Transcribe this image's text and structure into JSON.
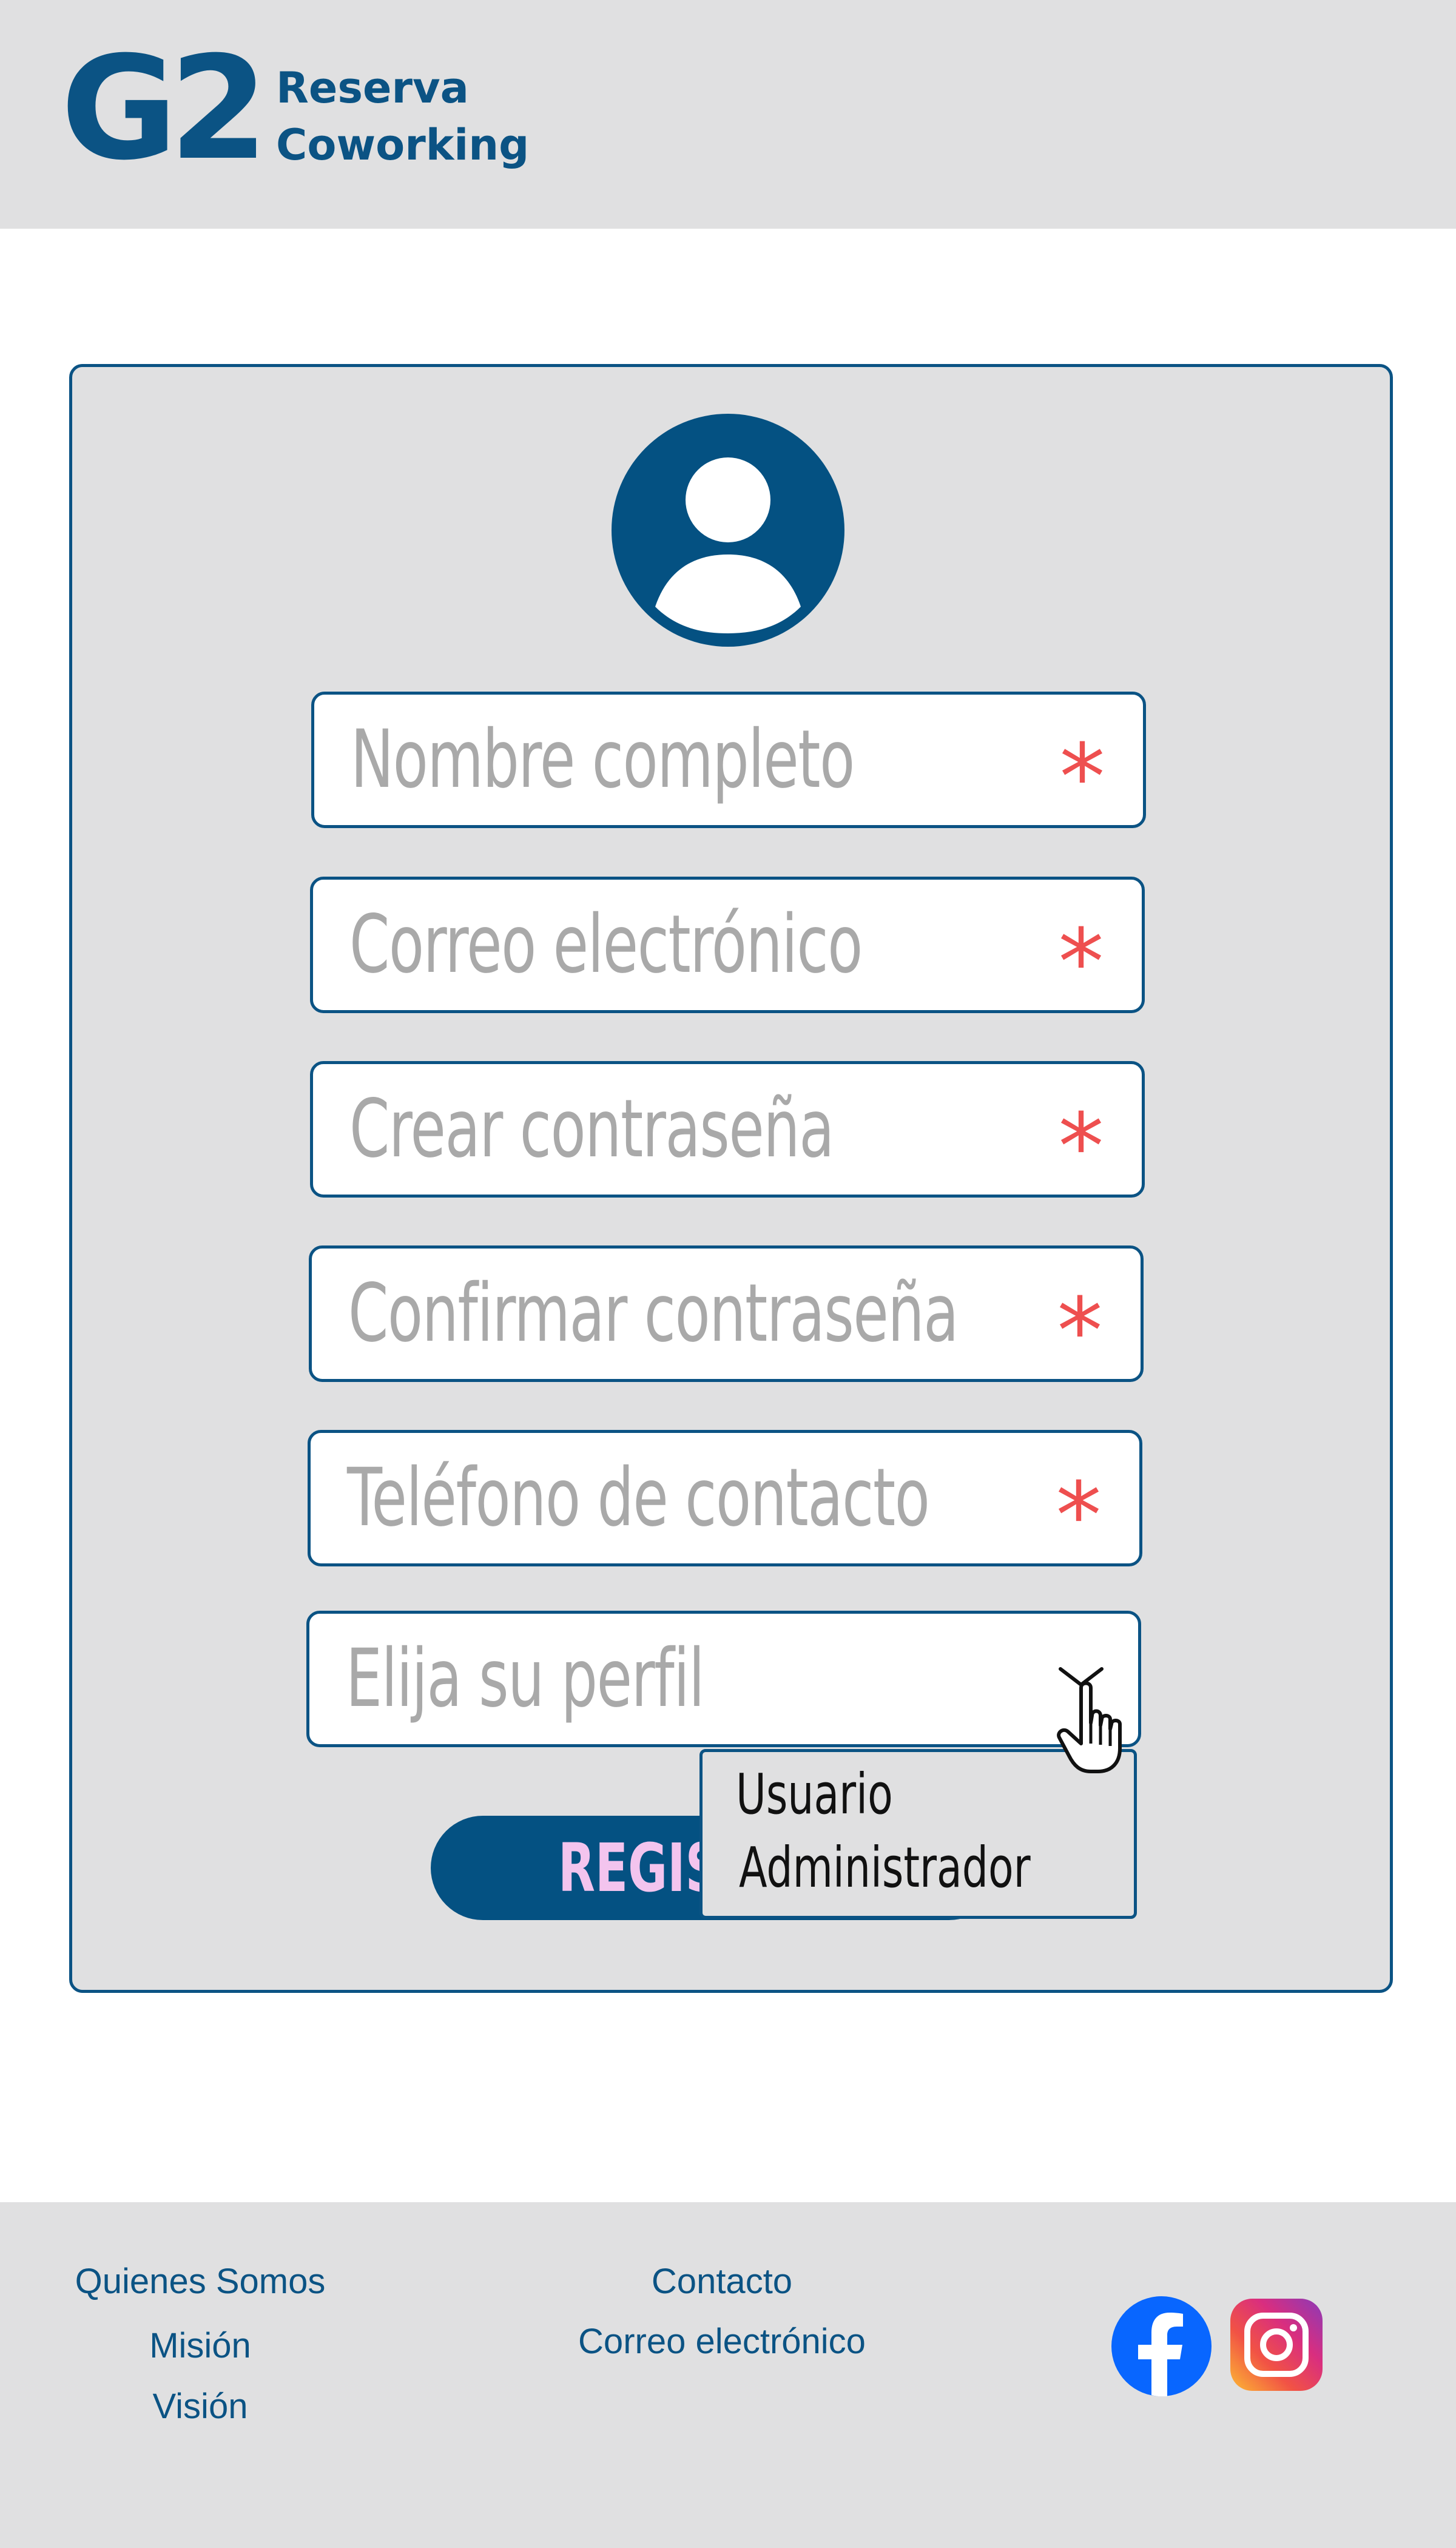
{
  "header": {
    "logo_mark": "G2",
    "logo_line1": "Reserva",
    "logo_line2": "Coworking"
  },
  "form": {
    "fields": [
      {
        "placeholder": "Nombre completo",
        "required_mark": "*"
      },
      {
        "placeholder": "Correo electrónico",
        "required_mark": "*"
      },
      {
        "placeholder": "Crear contraseña",
        "required_mark": "*"
      },
      {
        "placeholder": "Confirmar contraseña",
        "required_mark": "*"
      },
      {
        "placeholder": "Teléfono de contacto",
        "required_mark": "*"
      }
    ],
    "profile_select": {
      "placeholder": "Elija su perfil",
      "options": [
        "Usuario",
        "Administrador"
      ]
    },
    "submit_label": "REGIS"
  },
  "footer": {
    "links_left": [
      "Quienes Somos",
      "Misión",
      "Visión"
    ],
    "links_center": [
      "Contacto",
      "Correo electrónico"
    ],
    "social": [
      "facebook-icon",
      "instagram-icon"
    ]
  },
  "colors": {
    "brand": "#0b5384",
    "avatar_bg": "#045182",
    "panel_bg": "#e0e0e1",
    "required": "#ee4f4f",
    "placeholder": "#a9a9a9",
    "submit_text": "#f3c4ee"
  }
}
